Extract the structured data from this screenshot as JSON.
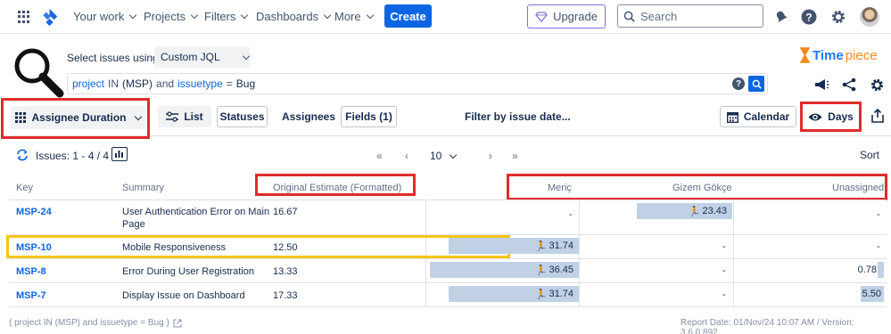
{
  "nav": {
    "items": [
      "Your work",
      "Projects",
      "Filters",
      "Dashboards",
      "More"
    ],
    "create_label": "Create",
    "upgrade_label": "Upgrade",
    "search_placeholder": "Search"
  },
  "query": {
    "select_label": "Select issues using",
    "mode": "Custom JQL",
    "jql_kw1": "project",
    "jql_op1": "IN",
    "jql_val1": "(MSP)",
    "jql_and": "and",
    "jql_kw2": "issuetype",
    "jql_op2": "=",
    "jql_val2": "Bug",
    "help_glyph": "?"
  },
  "brand": {
    "name_a": "Time",
    "name_b": "piece"
  },
  "toolbar": {
    "report_type": "Assignee Duration",
    "list_label": "List",
    "statuses_label": "Statuses",
    "assignees_label": "Assignees",
    "fields_label": "Fields (1)",
    "filter_label": "Filter by issue date...",
    "calendar_label": "Calendar",
    "days_label": "Days"
  },
  "list": {
    "issues_count": "Issues: 1 - 4 / 4",
    "page_size": "10",
    "sort_label": "Sort"
  },
  "table": {
    "headers": {
      "key": "Key",
      "summary": "Summary",
      "estimate": "Original Estimate (Formatted)",
      "col_a": "Meriç",
      "col_b": "Gizem Gökçe",
      "col_c": "Unassigned"
    },
    "rows": [
      {
        "key": "MSP-24",
        "summary1": "User Authentication Error on Main",
        "summary2": "Page",
        "estimate": "16.67",
        "a": "-",
        "b": "23.43",
        "c": "-",
        "a_fill": 0,
        "b_fill": 0.64,
        "c_fill": 0
      },
      {
        "key": "MSP-10",
        "summary1": "Mobile Responsiveness",
        "summary2": "",
        "estimate": "12.50",
        "a": "31.74",
        "b": "-",
        "c": "-",
        "a_fill": 0.87,
        "b_fill": 0,
        "c_fill": 0
      },
      {
        "key": "MSP-8",
        "summary1": "Error During User Registration",
        "summary2": "",
        "estimate": "13.33",
        "a": "36.45",
        "b": "-",
        "c": "0.78",
        "a_fill": 1.0,
        "b_fill": 0,
        "c_fill": 0.02
      },
      {
        "key": "MSP-7",
        "summary1": "Display Issue on Dashboard",
        "summary2": "",
        "estimate": "17.33",
        "a": "31.74",
        "b": "-",
        "c": "5.50",
        "a_fill": 0.87,
        "b_fill": 0,
        "c_fill": 0.15
      }
    ]
  },
  "footer": {
    "query_text": "( project IN (MSP) and issuetype = Bug )",
    "report_info": "Report Date: 01/Nov/24 10:07 AM / Version: 3.6.0.892"
  },
  "colors": {
    "accent": "#0c66e4",
    "highlight_red": "#e02c2c",
    "highlight_yellow": "#f5c518",
    "bar_fill": "#c0d1e6"
  }
}
